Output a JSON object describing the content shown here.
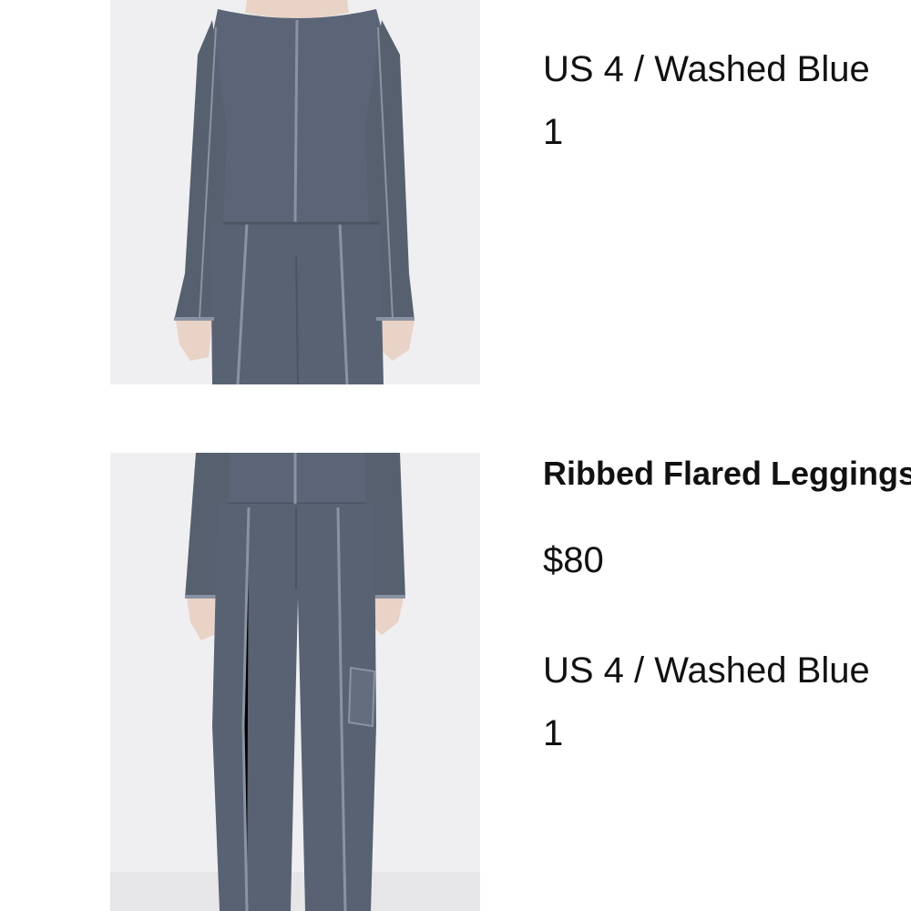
{
  "cart": {
    "items": [
      {
        "image_alt": "Ribbed top in washed blue",
        "variant": "US 4 / Washed Blue",
        "quantity": "1"
      },
      {
        "name": "Ribbed Flared Leggings",
        "price": "$80",
        "image_alt": "Ribbed flared leggings in washed blue",
        "variant": "US 4 / Washed Blue",
        "quantity": "1"
      }
    ]
  },
  "colors": {
    "product_fabric": "#5b6577",
    "product_seam": "#8a93a3",
    "image_background": "#efeff1",
    "text": "#111111"
  }
}
